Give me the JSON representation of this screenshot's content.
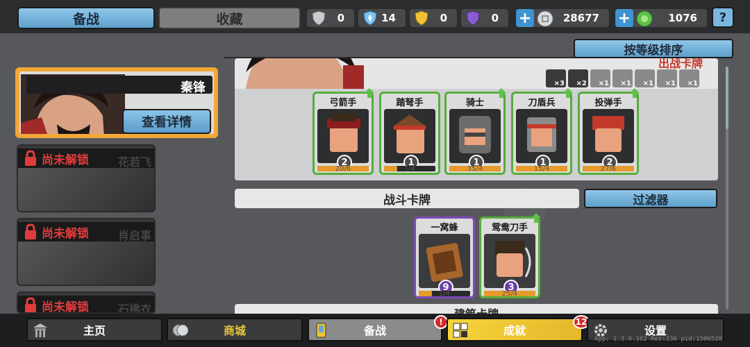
{
  "tabs": {
    "active": "备战",
    "inactive": "收藏"
  },
  "resources": {
    "shield_silver": "0",
    "crystal_blue": "14",
    "shield_gold": "0",
    "shield_purple": "0",
    "coins": "28677",
    "gems": "1076",
    "help": "?"
  },
  "sort_button": "按等级排序",
  "hero": {
    "name": "秦锋",
    "detail_button": "查看详情"
  },
  "locked_heroes": [
    {
      "status": "尚未解锁",
      "name": "花若飞"
    },
    {
      "status": "尚未解锁",
      "name": "肖启事"
    },
    {
      "status": "尚未解锁",
      "name": "石拂衣"
    }
  ],
  "deck": {
    "title": "出战卡牌",
    "slots": [
      "×3",
      "×2",
      "×1",
      "×1",
      "×1",
      "×1",
      "×1"
    ],
    "units": [
      {
        "name": "弓箭手",
        "level": "2",
        "progress": "20/6",
        "fill": 1.0
      },
      {
        "name": "踏弩手",
        "level": "1",
        "progress": "1/4",
        "fill": 0.25
      },
      {
        "name": "骑士",
        "level": "1",
        "progress": "35/4",
        "fill": 1.0
      },
      {
        "name": "刀盾兵",
        "level": "1",
        "progress": "15/4",
        "fill": 1.0
      },
      {
        "name": "投弹手",
        "level": "2",
        "progress": "27/6",
        "fill": 1.0
      }
    ]
  },
  "battle_cards": {
    "label": "战斗卡牌",
    "filter": "过滤器",
    "cards": [
      {
        "name": "一窝蜂",
        "level": "9",
        "progress": "1/4",
        "fill": 0.25,
        "rarity": "purple"
      },
      {
        "name": "鸳鸯刀手",
        "level": "3",
        "progress": "25/4",
        "fill": 1.0,
        "rarity": "green"
      }
    ]
  },
  "building_cards": {
    "label": "建筑卡牌"
  },
  "nav": {
    "home": "主页",
    "shop": "商城",
    "prepare": "备战",
    "prepare_badge": "!",
    "achievements": "成就",
    "achievements_badge": "12",
    "settings": "设置"
  },
  "build_info": "App: 1.3.0.162 Res:236 pid:1506528"
}
